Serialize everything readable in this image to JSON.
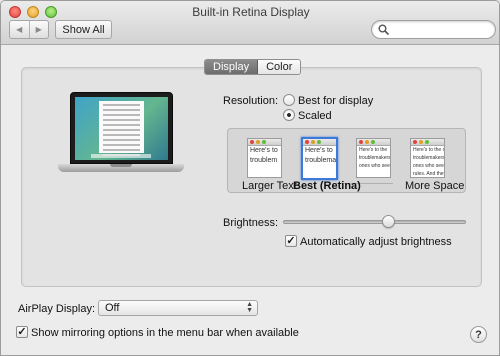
{
  "window": {
    "title": "Built-in Retina Display"
  },
  "toolbar": {
    "show_all_label": "Show All",
    "back_icon": "◀",
    "forward_icon": "▶"
  },
  "tabs": [
    {
      "label": "Display",
      "active": true
    },
    {
      "label": "Color",
      "active": false
    }
  ],
  "resolution": {
    "label": "Resolution:",
    "options": [
      {
        "label": "Best for display",
        "selected": false
      },
      {
        "label": "Scaled",
        "selected": true
      }
    ]
  },
  "scaled_options": {
    "larger_text_label": "Larger Text",
    "best_label": "Best (Retina)",
    "more_space_label": "More Space",
    "preview_lines": [
      "Here's to",
      "troublem"
    ],
    "preview_lines_best": [
      "Here's to",
      "troublemak"
    ],
    "preview_lines_c": [
      "Here's to the",
      "troublemakers.",
      "ones who see t"
    ],
    "preview_lines_d": [
      "Here's to the cra",
      "troublemakers. The",
      "ones who see thin",
      "rules. And they h"
    ]
  },
  "brightness": {
    "label": "Brightness:",
    "level": 0.58,
    "auto_label": "Automatically adjust brightness",
    "auto_checked": true
  },
  "airplay": {
    "label": "AirPlay Display:",
    "value": "Off"
  },
  "mirroring": {
    "label": "Show mirroring options in the menu bar when available",
    "checked": true
  },
  "help": {
    "glyph": "?"
  },
  "colors": {
    "selection": "#3d7ad8",
    "close": "#e0443e",
    "minimize": "#dea123",
    "zoom": "#5fbf38"
  }
}
